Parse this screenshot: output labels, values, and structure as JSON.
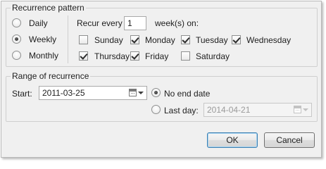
{
  "recurrence_pattern": {
    "title": "Recurrence pattern",
    "frequency_options": [
      {
        "label": "Daily",
        "selected": false
      },
      {
        "label": "Weekly",
        "selected": true
      },
      {
        "label": "Monthly",
        "selected": false
      }
    ],
    "recur_every_label": "Recur every",
    "recur_every_value": "1",
    "weeks_on_label": "week(s) on:",
    "days": [
      {
        "label": "Sunday",
        "checked": false
      },
      {
        "label": "Monday",
        "checked": true
      },
      {
        "label": "Tuesday",
        "checked": true
      },
      {
        "label": "Wednesday",
        "checked": true
      },
      {
        "label": "Thursday",
        "checked": true
      },
      {
        "label": "Friday",
        "checked": true
      },
      {
        "label": "Saturday",
        "checked": false
      }
    ]
  },
  "range_of_recurrence": {
    "title": "Range of recurrence",
    "start_label": "Start:",
    "start_value": "2011-03-25",
    "no_end_date_label": "No end date",
    "no_end_date_selected": true,
    "last_day_label": "Last day:",
    "last_day_value": "2014-04-21",
    "last_day_enabled": false
  },
  "buttons": {
    "ok_label": "OK",
    "cancel_label": "Cancel"
  },
  "icons": {
    "date_picker": "calendar-icon",
    "dropdown": "chevron-down-icon"
  }
}
